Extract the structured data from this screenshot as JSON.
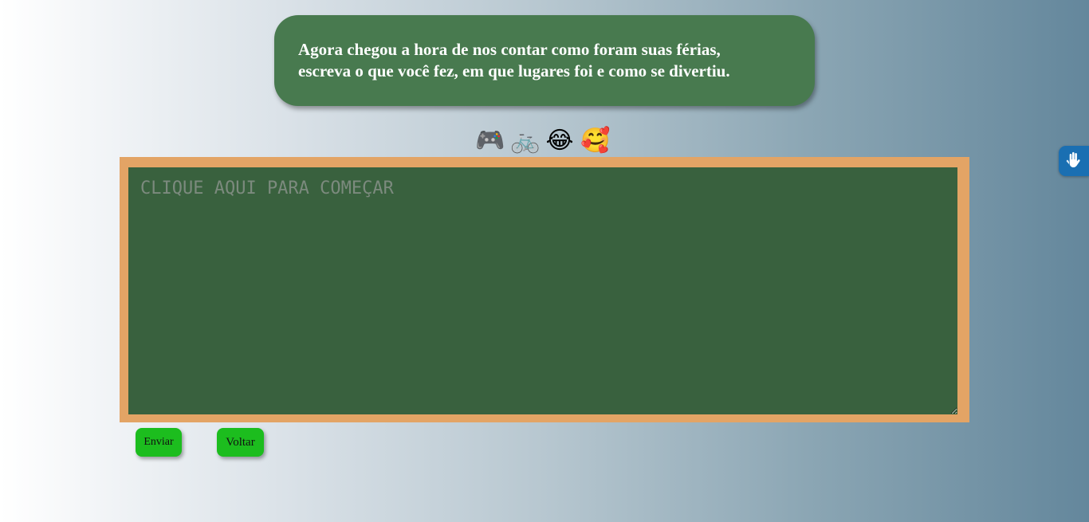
{
  "bubble": {
    "line1": "Agora chegou a hora de nos contar como foram suas férias,",
    "line2": "escreva o que você fez, em que lugares foi e como se divertiu."
  },
  "emojis": [
    "🎮",
    "🚲",
    "😂",
    "🥰"
  ],
  "emoji_icons": [
    "game-controller-icon",
    "bicycle-icon",
    "laughing-face-icon",
    "smiling-face-with-hearts-icon"
  ],
  "board": {
    "value": "",
    "placeholder": "CLIQUE AQUI PARA COMEÇAR"
  },
  "buttons": {
    "enviar": "Enviar",
    "voltar": "Voltar"
  },
  "accessibility": {
    "icon": "sign-language-hands-icon"
  },
  "colors": {
    "bubble": "#487a4f",
    "board": "#39613e",
    "frame": "#e3a465",
    "button": "#1cbd1e",
    "a11y": "#1a6fb2"
  }
}
